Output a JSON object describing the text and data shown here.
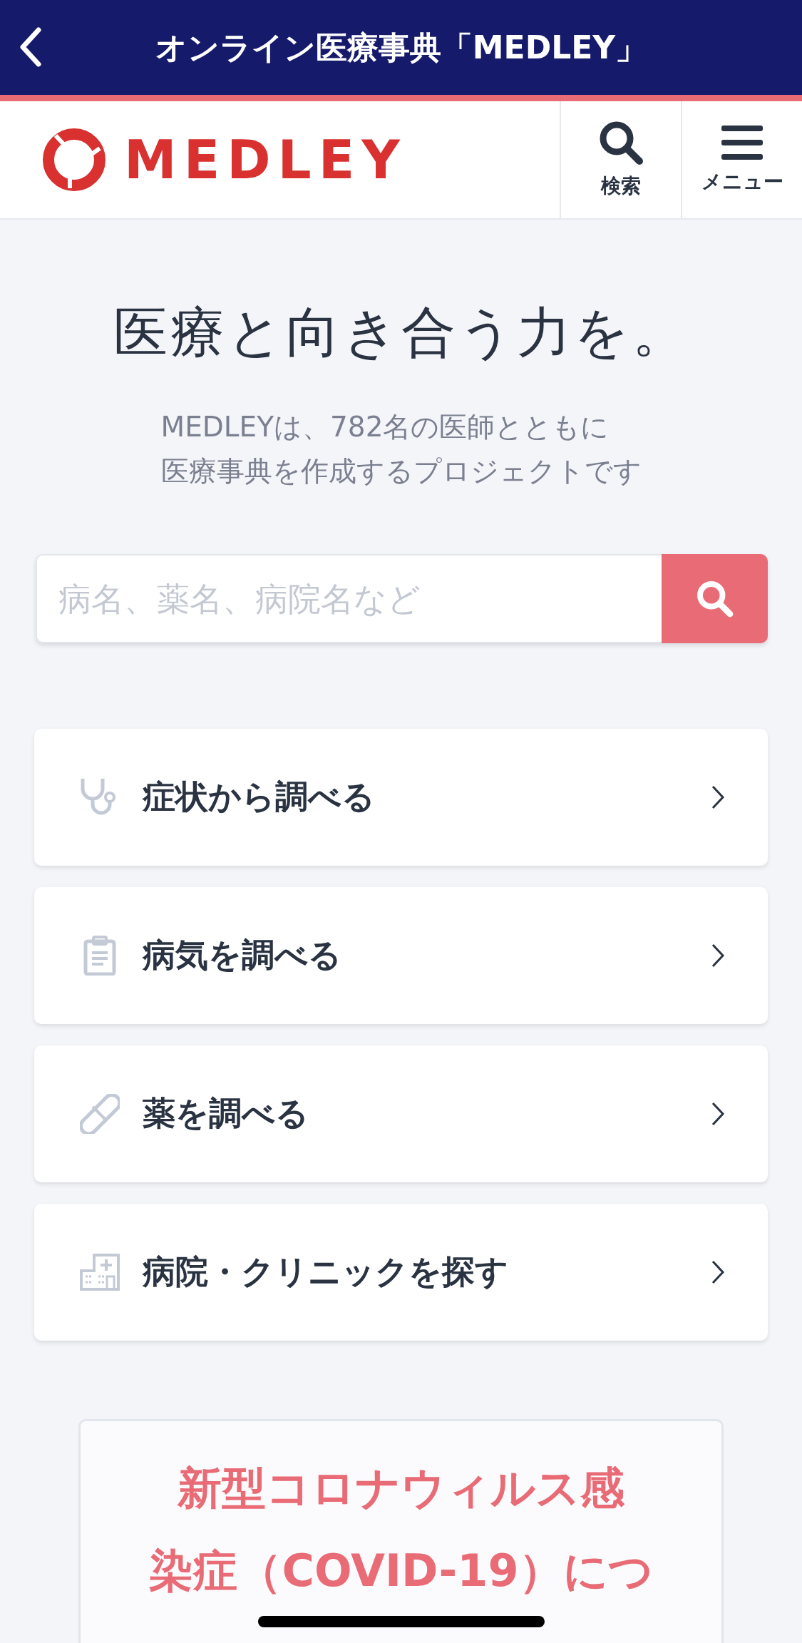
{
  "top_bar": {
    "title": "オンライン医療事典「MEDLEY」"
  },
  "header": {
    "logo": "MEDLEY",
    "buttons": [
      {
        "kind": "search",
        "label": "検索"
      },
      {
        "kind": "menu",
        "label": "メニュー"
      }
    ]
  },
  "hero": {
    "headline": "医療と向き合う力を。",
    "subtitle": [
      "MEDLEYは、782名の医師とともに",
      "医療事典を作成するプロジェクトです"
    ]
  },
  "search": {
    "placeholder": "病名、薬名、病院名など"
  },
  "nav_cards": [
    {
      "label": "症状から調べる"
    },
    {
      "label": "病気を調べる"
    },
    {
      "label": "薬を調べる"
    },
    {
      "label": "病院・クリニックを探す"
    }
  ],
  "notice": {
    "title_lines": [
      "新型コロナウィルス感",
      "染症（COVID-19）につ"
    ]
  }
}
